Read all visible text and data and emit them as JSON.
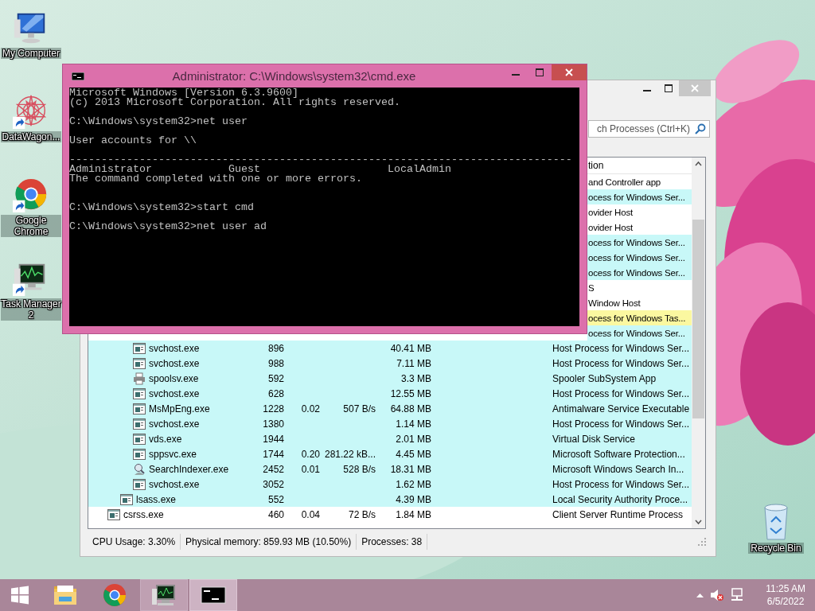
{
  "desktop": {
    "icons": [
      {
        "kind": "computer",
        "label": "My Computer",
        "shortcut": false
      },
      {
        "kind": "mandala",
        "label": "DataWagon...",
        "shortcut": true
      },
      {
        "kind": "chrome",
        "label": "Google Chrome",
        "shortcut": true
      },
      {
        "kind": "monitor",
        "label": "Task Manager 2",
        "shortcut": true
      }
    ],
    "recycle_bin": {
      "label": "Recycle Bin"
    }
  },
  "task_manager": {
    "active": false,
    "search": {
      "placeholder": "ch Processes (Ctrl+K)"
    },
    "header_fragment": "tion",
    "rows": [
      {
        "children": [
          {
            "fragment": "and Controller app",
            "color": "#ffffff",
            "children": [
              {
                "fragment": "ocess for Windows Ser...",
                "color": "#c8f8f8"
              },
              {
                "fragment": "ovider Host",
                "color": "#ffffff"
              },
              {
                "fragment": "ovider Host",
                "color": "#ffffff"
              },
              {
                "fragment": "ocess for Windows Ser...",
                "color": "#c8f8f8"
              },
              {
                "fragment": "ocess for Windows Ser...",
                "color": "#c8f8f8"
              },
              {
                "fragment": "ocess for Windows Ser...",
                "color": "#c8f8f8"
              },
              {
                "fragment": "S",
                "color": "#ffffff"
              },
              {
                "fragment": "Window Host",
                "color": "#ffffff"
              },
              {
                "fragment": "ocess for Windows Tas...",
                "color": "#fbf8a0"
              },
              {
                "fragment": "ocess for Windows Ser...",
                "color": "#c8f8f8"
              },
              {
                "kind": "app",
                "name": "svchost.exe",
                "pid": "896",
                "memory": "40.41 MB",
                "description": "Host Process for Windows Ser...",
                "color": "#c8f8f8"
              },
              {
                "kind": "app",
                "name": "svchost.exe",
                "pid": "988",
                "memory": "7.11 MB",
                "description": "Host Process for Windows Ser...",
                "color": "#c8f8f8"
              },
              {
                "kind": "printer",
                "name": "spoolsv.exe",
                "pid": "592",
                "memory": "3.3 MB",
                "description": "Spooler SubSystem App",
                "color": "#c8f8f8"
              },
              {
                "kind": "app",
                "name": "svchost.exe",
                "pid": "628",
                "memory": "12.55 MB",
                "description": "Host Process for Windows Ser...",
                "color": "#c8f8f8"
              },
              {
                "kind": "app",
                "name": "MsMpEng.exe",
                "pid": "1228",
                "cpu": "0.02",
                "io": "507 B/s",
                "memory": "64.88 MB",
                "description": "Antimalware Service Executable",
                "color": "#c8f8f8"
              },
              {
                "kind": "app",
                "name": "svchost.exe",
                "pid": "1380",
                "memory": "1.14 MB",
                "description": "Host Process for Windows Ser...",
                "color": "#c8f8f8"
              },
              {
                "kind": "app",
                "name": "vds.exe",
                "pid": "1944",
                "memory": "2.01 MB",
                "description": "Virtual Disk Service",
                "color": "#c8f8f8"
              },
              {
                "kind": "app",
                "name": "sppsvc.exe",
                "pid": "1744",
                "cpu": "0.20",
                "io": "281.22 kB...",
                "memory": "4.45 MB",
                "description": "Microsoft Software Protection...",
                "color": "#c8f8f8"
              },
              {
                "kind": "search",
                "name": "SearchIndexer.exe",
                "pid": "2452",
                "cpu": "0.01",
                "io": "528 B/s",
                "memory": "18.31 MB",
                "description": "Microsoft Windows Search In...",
                "color": "#c8f8f8"
              },
              {
                "kind": "app",
                "name": "svchost.exe",
                "pid": "3052",
                "memory": "1.62 MB",
                "description": "Host Process for Windows Ser...",
                "color": "#c8f8f8"
              }
            ]
          },
          {
            "kind": "app",
            "name": "lsass.exe",
            "pid": "552",
            "memory": "4.39 MB",
            "description": "Local Security Authority Proce...",
            "color": "#c8f8f8"
          }
        ]
      },
      {
        "kind": "app",
        "name": "csrss.exe",
        "pid": "460",
        "cpu": "0.04",
        "io": "72 B/s",
        "memory": "1.84 MB",
        "description": "Client Server Runtime Process",
        "color": "#ffffff"
      }
    ],
    "status_bar": [
      "CPU Usage: 3.30%",
      "Physical memory: 859.93 MB (10.50%)",
      "Processes: 38"
    ]
  },
  "cmd": {
    "active": true,
    "title": "Administrator: C:\\Windows\\system32\\cmd.exe",
    "console": "Microsoft Windows [Version 6.3.9600]\n(c) 2013 Microsoft Corporation. All rights reserved.\n\nC:\\Windows\\system32>net user\n\nUser accounts for \\\\\n\n-------------------------------------------------------------------------------\nAdministrator            Guest                    LocalAdmin\nThe command completed with one or more errors.\n\n\nC:\\Windows\\system32>start cmd\n\nC:\\Windows\\system32>net user ad"
  },
  "taskbar": {
    "apps": [
      {
        "kind": "explorer",
        "running": false,
        "active": false
      },
      {
        "kind": "chrome",
        "running": false,
        "active": false
      },
      {
        "kind": "monitor",
        "running": true,
        "active": false
      },
      {
        "kind": "console",
        "running": true,
        "active": true
      }
    ],
    "clock": {
      "time": "11:25 AM",
      "date": "6/5/2022"
    }
  }
}
